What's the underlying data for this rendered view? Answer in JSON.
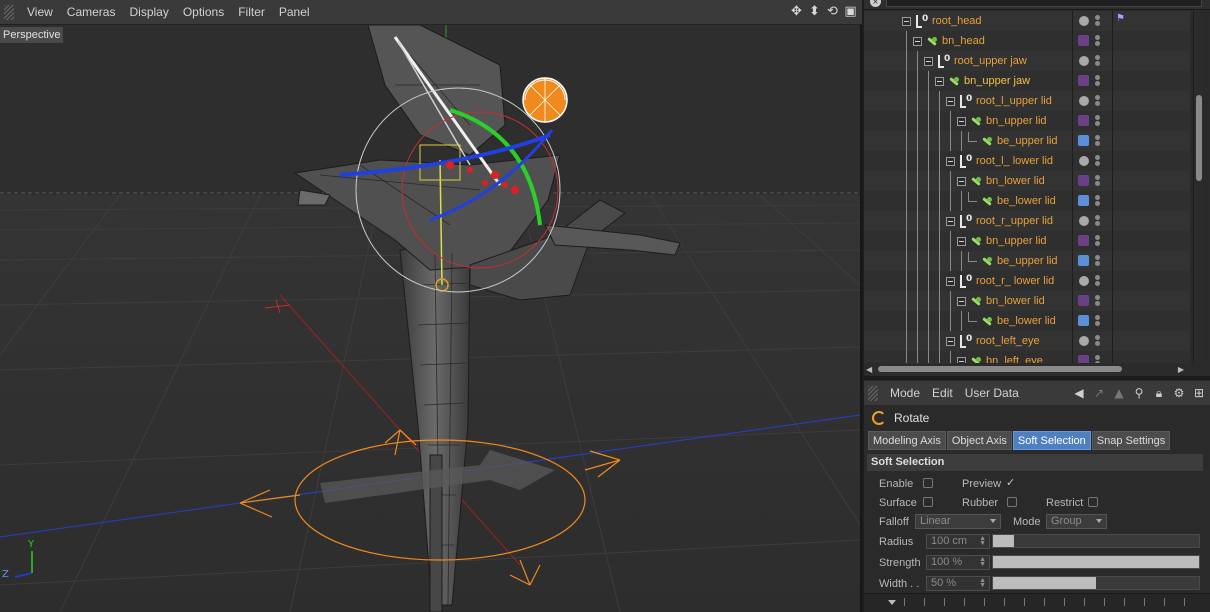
{
  "viewport": {
    "menu": [
      "View",
      "Cameras",
      "Display",
      "Options",
      "Filter",
      "Panel"
    ],
    "camera_label": "Perspective",
    "nav_icons": [
      "move-icon",
      "zoom-icon",
      "rotate-view-icon",
      "toggle-layout-icon"
    ],
    "axis_labels": {
      "y": "Y",
      "z": "Z"
    }
  },
  "object_manager": {
    "close_glyph": "×",
    "items": [
      {
        "name": "root_head",
        "type": "null",
        "tag": "circle",
        "active": false
      },
      {
        "name": "bn_head",
        "type": "bone",
        "tag": "purple",
        "active": false
      },
      {
        "name": "root_upper jaw",
        "type": "null",
        "tag": "circle",
        "active": false
      },
      {
        "name": "bn_upper jaw",
        "type": "bone",
        "tag": "purple",
        "active": true
      },
      {
        "name": "root_l_upper lid",
        "type": "null",
        "tag": "circle",
        "active": false
      },
      {
        "name": "bn_upper lid",
        "type": "bone",
        "tag": "purple",
        "active": false
      },
      {
        "name": "be_upper lid",
        "type": "bone",
        "tag": "blue",
        "active": false
      },
      {
        "name": "root_l_ lower lid",
        "type": "null",
        "tag": "circle",
        "active": false
      },
      {
        "name": "bn_lower lid",
        "type": "bone",
        "tag": "purple",
        "active": false
      },
      {
        "name": "be_lower lid",
        "type": "bone",
        "tag": "blue",
        "active": false
      },
      {
        "name": "root_r_upper lid",
        "type": "null",
        "tag": "circle",
        "active": false
      },
      {
        "name": "bn_upper lid",
        "type": "bone",
        "tag": "purple",
        "active": false
      },
      {
        "name": "be_upper lid",
        "type": "bone",
        "tag": "blue",
        "active": false
      },
      {
        "name": "root_r_ lower lid",
        "type": "null",
        "tag": "circle",
        "active": false
      },
      {
        "name": "bn_lower lid",
        "type": "bone",
        "tag": "purple",
        "active": false
      },
      {
        "name": "be_lower lid",
        "type": "bone",
        "tag": "blue",
        "active": false
      },
      {
        "name": "root_left_eye",
        "type": "null",
        "tag": "circle",
        "active": false
      },
      {
        "name": "bn_left_eye",
        "type": "bone",
        "tag": "purple",
        "active": false
      }
    ],
    "tag_colors": {
      "purple": "#6b3f86",
      "blue": "#5d8fd8"
    }
  },
  "attributes": {
    "menu": [
      "Mode",
      "Edit",
      "User Data"
    ],
    "icons": [
      "back-arrow-icon",
      "up-arrow-icon",
      "forward-arrow-icon",
      "search-icon",
      "lock-icon",
      "settings-icon",
      "new-panel-icon"
    ],
    "tool_name": "Rotate",
    "tabs": [
      {
        "label": "Modeling Axis",
        "active": false
      },
      {
        "label": "Object Axis",
        "active": false
      },
      {
        "label": "Soft Selection",
        "active": true
      },
      {
        "label": "Snap Settings",
        "active": false
      }
    ],
    "section_title": "Soft Selection",
    "enable_label": "Enable",
    "preview_label": "Preview",
    "preview_check": "✓",
    "surface_label": "Surface",
    "rubber_label": "Rubber",
    "restrict_label": "Restrict",
    "falloff_label": "Falloff",
    "falloff_value": "Linear",
    "mode_label": "Mode",
    "mode_value": "Group",
    "radius_label": "Radius",
    "radius_value": "100 cm",
    "radius_fraction": 0.1,
    "strength_label": "Strength",
    "strength_value": "100 %",
    "strength_fraction": 1.0,
    "width_label": "Width . .",
    "width_value": "50 %",
    "width_fraction": 0.5
  },
  "colors": {
    "object_name": "#e8a13a",
    "active_tab": "#4e7fc1",
    "gizmo_orange": "#f08a1c"
  }
}
